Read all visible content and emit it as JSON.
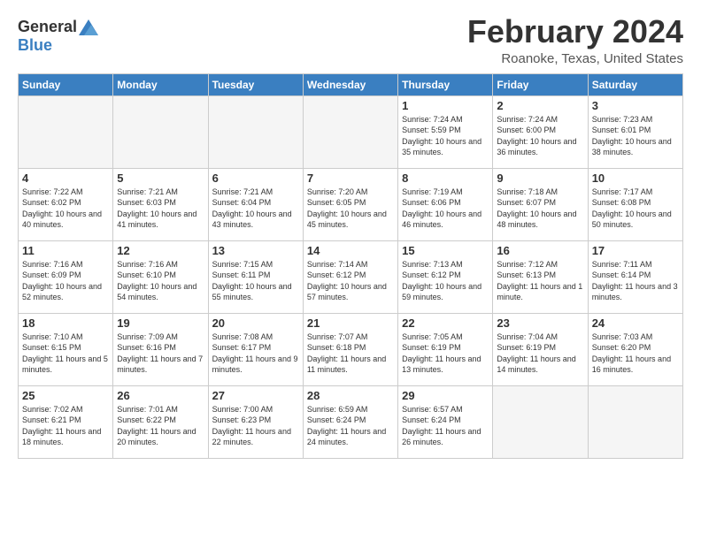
{
  "header": {
    "logo_general": "General",
    "logo_blue": "Blue",
    "title": "February 2024",
    "location": "Roanoke, Texas, United States"
  },
  "weekdays": [
    "Sunday",
    "Monday",
    "Tuesday",
    "Wednesday",
    "Thursday",
    "Friday",
    "Saturday"
  ],
  "weeks": [
    [
      {
        "day": "",
        "empty": true
      },
      {
        "day": "",
        "empty": true
      },
      {
        "day": "",
        "empty": true
      },
      {
        "day": "",
        "empty": true
      },
      {
        "day": "1",
        "sunrise": "7:24 AM",
        "sunset": "5:59 PM",
        "daylight": "10 hours and 35 minutes."
      },
      {
        "day": "2",
        "sunrise": "7:24 AM",
        "sunset": "6:00 PM",
        "daylight": "10 hours and 36 minutes."
      },
      {
        "day": "3",
        "sunrise": "7:23 AM",
        "sunset": "6:01 PM",
        "daylight": "10 hours and 38 minutes."
      }
    ],
    [
      {
        "day": "4",
        "sunrise": "7:22 AM",
        "sunset": "6:02 PM",
        "daylight": "10 hours and 40 minutes."
      },
      {
        "day": "5",
        "sunrise": "7:21 AM",
        "sunset": "6:03 PM",
        "daylight": "10 hours and 41 minutes."
      },
      {
        "day": "6",
        "sunrise": "7:21 AM",
        "sunset": "6:04 PM",
        "daylight": "10 hours and 43 minutes."
      },
      {
        "day": "7",
        "sunrise": "7:20 AM",
        "sunset": "6:05 PM",
        "daylight": "10 hours and 45 minutes."
      },
      {
        "day": "8",
        "sunrise": "7:19 AM",
        "sunset": "6:06 PM",
        "daylight": "10 hours and 46 minutes."
      },
      {
        "day": "9",
        "sunrise": "7:18 AM",
        "sunset": "6:07 PM",
        "daylight": "10 hours and 48 minutes."
      },
      {
        "day": "10",
        "sunrise": "7:17 AM",
        "sunset": "6:08 PM",
        "daylight": "10 hours and 50 minutes."
      }
    ],
    [
      {
        "day": "11",
        "sunrise": "7:16 AM",
        "sunset": "6:09 PM",
        "daylight": "10 hours and 52 minutes."
      },
      {
        "day": "12",
        "sunrise": "7:16 AM",
        "sunset": "6:10 PM",
        "daylight": "10 hours and 54 minutes."
      },
      {
        "day": "13",
        "sunrise": "7:15 AM",
        "sunset": "6:11 PM",
        "daylight": "10 hours and 55 minutes."
      },
      {
        "day": "14",
        "sunrise": "7:14 AM",
        "sunset": "6:12 PM",
        "daylight": "10 hours and 57 minutes."
      },
      {
        "day": "15",
        "sunrise": "7:13 AM",
        "sunset": "6:12 PM",
        "daylight": "10 hours and 59 minutes."
      },
      {
        "day": "16",
        "sunrise": "7:12 AM",
        "sunset": "6:13 PM",
        "daylight": "11 hours and 1 minute."
      },
      {
        "day": "17",
        "sunrise": "7:11 AM",
        "sunset": "6:14 PM",
        "daylight": "11 hours and 3 minutes."
      }
    ],
    [
      {
        "day": "18",
        "sunrise": "7:10 AM",
        "sunset": "6:15 PM",
        "daylight": "11 hours and 5 minutes."
      },
      {
        "day": "19",
        "sunrise": "7:09 AM",
        "sunset": "6:16 PM",
        "daylight": "11 hours and 7 minutes."
      },
      {
        "day": "20",
        "sunrise": "7:08 AM",
        "sunset": "6:17 PM",
        "daylight": "11 hours and 9 minutes."
      },
      {
        "day": "21",
        "sunrise": "7:07 AM",
        "sunset": "6:18 PM",
        "daylight": "11 hours and 11 minutes."
      },
      {
        "day": "22",
        "sunrise": "7:05 AM",
        "sunset": "6:19 PM",
        "daylight": "11 hours and 13 minutes."
      },
      {
        "day": "23",
        "sunrise": "7:04 AM",
        "sunset": "6:19 PM",
        "daylight": "11 hours and 14 minutes."
      },
      {
        "day": "24",
        "sunrise": "7:03 AM",
        "sunset": "6:20 PM",
        "daylight": "11 hours and 16 minutes."
      }
    ],
    [
      {
        "day": "25",
        "sunrise": "7:02 AM",
        "sunset": "6:21 PM",
        "daylight": "11 hours and 18 minutes."
      },
      {
        "day": "26",
        "sunrise": "7:01 AM",
        "sunset": "6:22 PM",
        "daylight": "11 hours and 20 minutes."
      },
      {
        "day": "27",
        "sunrise": "7:00 AM",
        "sunset": "6:23 PM",
        "daylight": "11 hours and 22 minutes."
      },
      {
        "day": "28",
        "sunrise": "6:59 AM",
        "sunset": "6:24 PM",
        "daylight": "11 hours and 24 minutes."
      },
      {
        "day": "29",
        "sunrise": "6:57 AM",
        "sunset": "6:24 PM",
        "daylight": "11 hours and 26 minutes."
      },
      {
        "day": "",
        "empty": true
      },
      {
        "day": "",
        "empty": true
      }
    ]
  ]
}
